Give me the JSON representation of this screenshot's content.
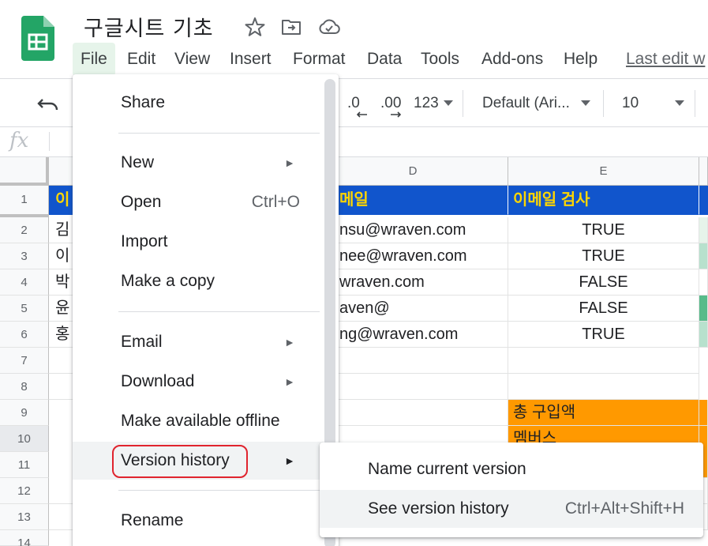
{
  "app": {
    "doc_title": "구글시트 기초"
  },
  "header_icons": [
    "star-icon",
    "move-to-folder-icon",
    "cloud-saved-icon"
  ],
  "menubar": {
    "items": [
      "File",
      "Edit",
      "View",
      "Insert",
      "Format",
      "Data",
      "Tools",
      "Add-ons",
      "Help"
    ],
    "last_edit": "Last edit w"
  },
  "toolbar": {
    "decrease_decimal": ".0",
    "increase_decimal": ".00",
    "more_formats": "123",
    "font": "Default (Ari...",
    "font_size": "10"
  },
  "formula_bar": {
    "fx": "fx"
  },
  "grid": {
    "columns": [
      "D",
      "E"
    ],
    "rows": [
      "1",
      "2",
      "3",
      "4",
      "5",
      "6",
      "7",
      "8",
      "9",
      "10",
      "11",
      "12",
      "13",
      "14"
    ],
    "a_col": [
      "이",
      "김",
      "이",
      "박",
      "윤",
      "홍"
    ],
    "d_col": [
      "메일",
      "nsu@wraven.com",
      "nee@wraven.com",
      "wraven.com",
      "aven@",
      "ng@wraven.com"
    ],
    "e_col": [
      "이메일 검사",
      "TRUE",
      "TRUE",
      "FALSE",
      "FALSE",
      "TRUE"
    ],
    "e9": "총 구입액",
    "e10": "멤버스"
  },
  "file_menu": {
    "share": "Share",
    "new": "New",
    "open": "Open",
    "open_shortcut": "Ctrl+O",
    "import": "Import",
    "make_copy": "Make a copy",
    "email": "Email",
    "download": "Download",
    "offline": "Make available offline",
    "version_history": "Version history",
    "rename": "Rename",
    "arrow": "►"
  },
  "version_submenu": {
    "name_current": "Name current version",
    "see_history": "See version history",
    "see_history_shortcut": "Ctrl+Alt+Shift+H"
  },
  "colors": {
    "header_fill": "#1155cc",
    "header_text": "#ffd600",
    "orange_fill": "#ff9900",
    "highlight_outline": "#e0242e",
    "logo_green": "#23a566"
  }
}
